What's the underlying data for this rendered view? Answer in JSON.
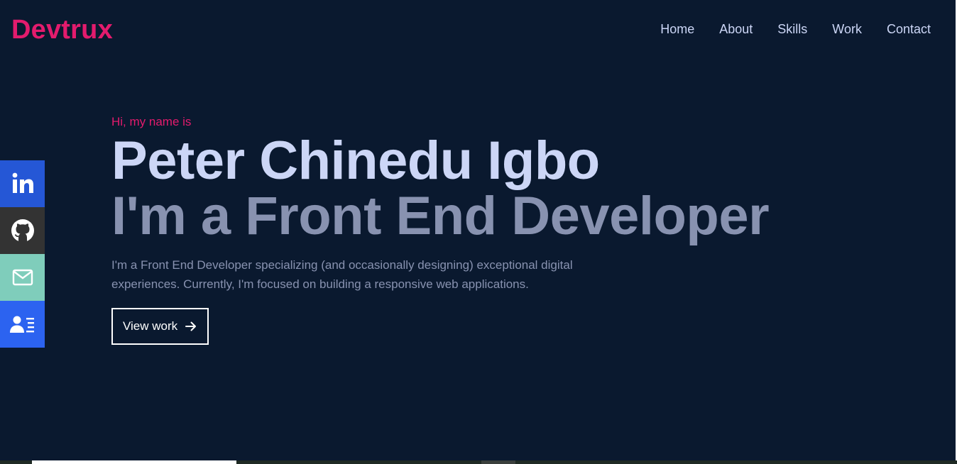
{
  "brand": {
    "logo": "Devtrux",
    "accent_color": "#e31b6d",
    "background_color": "#0a192f"
  },
  "nav": {
    "items": [
      {
        "label": "Home"
      },
      {
        "label": "About"
      },
      {
        "label": "Skills"
      },
      {
        "label": "Work"
      },
      {
        "label": "Contact"
      }
    ]
  },
  "social": {
    "items": [
      {
        "icon": "linkedin-icon",
        "color": "#2557d6"
      },
      {
        "icon": "github-icon",
        "color": "#333333"
      },
      {
        "icon": "mail-icon",
        "color": "#7fcdbb"
      },
      {
        "icon": "resume-icon",
        "color": "#2c63f0"
      }
    ]
  },
  "hero": {
    "greeting": "Hi, my name is",
    "name": "Peter Chinedu Igbo",
    "role": "I'm a Front End Developer",
    "description": "I'm a Front End Developer specializing (and occasionally designing) exceptional digital experiences. Currently, I'm focused on building a responsive web applications.",
    "button_label": "View work",
    "button_icon": "arrow-right-icon"
  }
}
